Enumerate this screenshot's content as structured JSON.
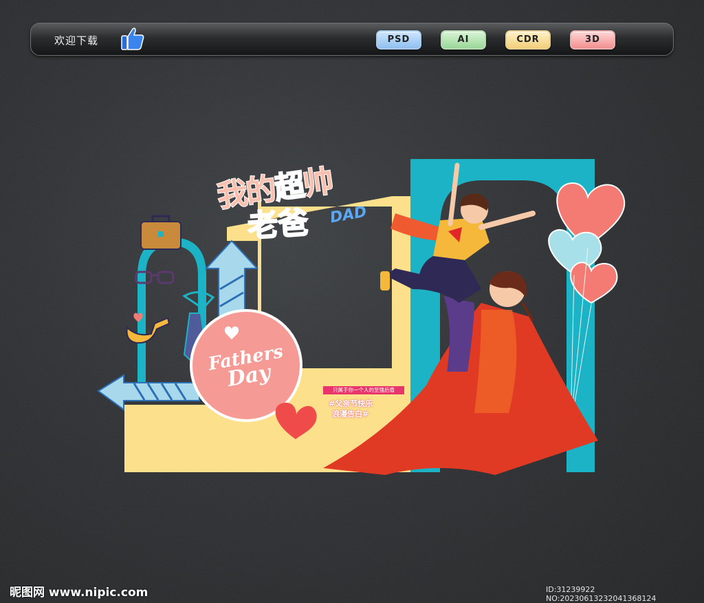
{
  "toolbar": {
    "welcome": "欢迎下载",
    "formats": [
      "PSD",
      "AI",
      "CDR",
      "3D"
    ]
  },
  "artwork": {
    "title_line1_a": "我的",
    "title_line1_b": "超",
    "title_line1_c": "帅",
    "title_line2": "老爸",
    "title_dad": "DAD",
    "fathers_day_line1": "Fathers",
    "fathers_day_line2": "Day",
    "caption_small": "只属于你一个人的至强后盾",
    "tag_line1": "#父亲节快乐",
    "tag_line2": "浪漫告白#"
  },
  "watermark": {
    "left": "昵图网 www.nipic.com",
    "right": "ID:31239922 NO:20230613232041368124"
  },
  "colors": {
    "background": "#2b2d30",
    "yellow_frame": "#fde08b",
    "teal_frame": "#1bb3c5",
    "coral": "#f47b73",
    "cape_red": "#e03a24"
  }
}
